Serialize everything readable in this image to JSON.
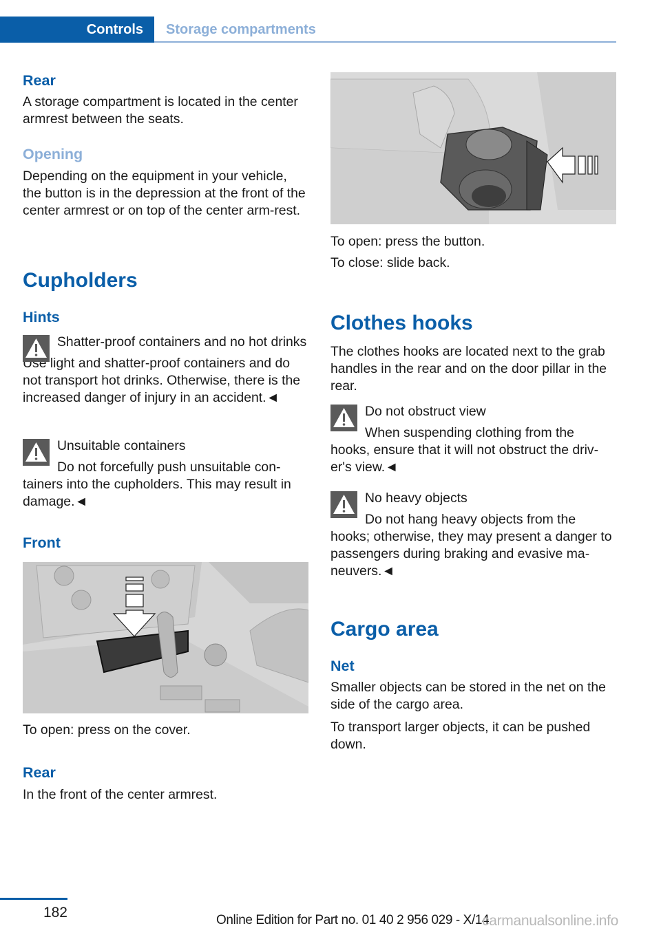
{
  "header": {
    "section": "Controls",
    "chapter": "Storage compartments"
  },
  "left": {
    "rear_heading": "Rear",
    "rear_text": "A storage compartment is located in the center armrest between the seats.",
    "opening_heading": "Opening",
    "opening_text": "Depending on the equipment in your vehicle, the button is in the depression at the front of the center armrest or on top of the center arm-rest.",
    "cupholders_heading": "Cupholders",
    "hints_heading": "Hints",
    "warnings": [
      {
        "icon": "warning-triangle-icon",
        "title": "Shatter-proof containers and no hot drinks",
        "body": "Use light and shatter-proof containers and do not transport hot drinks. Otherwise, there is the increased danger of injury in an accident.◄"
      },
      {
        "icon": "warning-triangle-icon",
        "title": "Unsuitable containers",
        "body": "Do not forcefully push unsuitable con-tainers into the cupholders. This may result in damage.◄"
      }
    ],
    "front_heading": "Front",
    "front_figure_alt": "Front cupholder cover in center console with arrow indicating press",
    "front_caption": "To open: press on the cover.",
    "rear2_heading": "Rear",
    "rear2_text": "In the front of the center armrest."
  },
  "right": {
    "figure_alt": "Rear cupholder in the front of the center armrest with arrow pointing to button",
    "open_text": "To open: press the button.",
    "close_text": "To close: slide back.",
    "clothes_heading": "Clothes hooks",
    "clothes_text": "The clothes hooks are located next to the grab handles in the rear and on the door pillar in the rear.",
    "warnings": [
      {
        "icon": "warning-triangle-icon",
        "title": "Do not obstruct view",
        "body": "When suspending clothing from the hooks, ensure that it will not obstruct the driv-er's view.◄"
      },
      {
        "icon": "warning-triangle-icon",
        "title": "No heavy objects",
        "body": "Do not hang heavy objects from the hooks; otherwise, they may present a danger to passengers during braking and evasive ma-neuvers.◄"
      }
    ],
    "cargo_heading": "Cargo area",
    "net_heading": "Net",
    "net_text1": "Smaller objects can be stored in the net on the side of the cargo area.",
    "net_text2": "To transport larger objects, it can be pushed down."
  },
  "footer": {
    "page_number": "182",
    "edition": "Online Edition for Part no. 01 40 2 956 029 - X/14",
    "watermark": "carmanualsonline.info"
  },
  "colors": {
    "brand_blue": "#0a5ea8",
    "light_blue": "#8cafd8",
    "warning_gray": "#5a5a5a"
  }
}
